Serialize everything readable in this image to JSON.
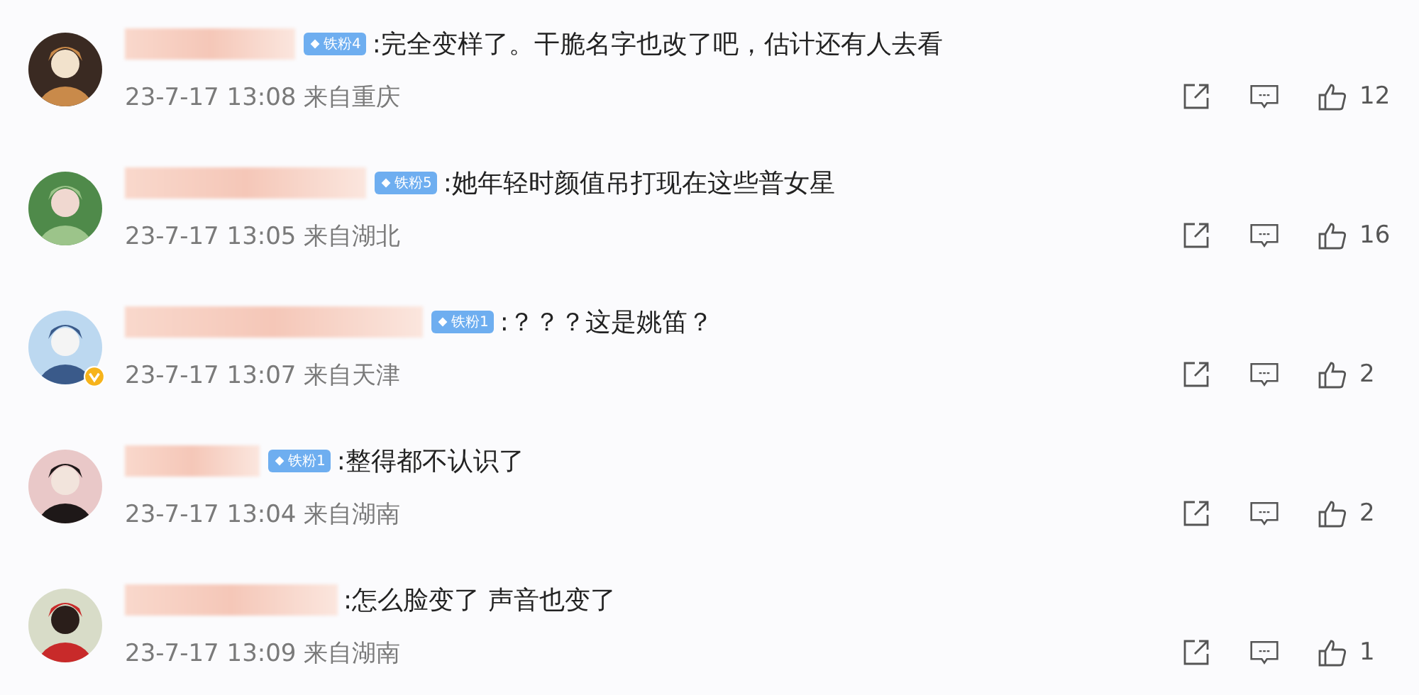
{
  "comments": [
    {
      "avatar": {
        "kind": "picture",
        "verified": false
      },
      "badge": "铁粉4",
      "text": ":完全变样了。干脆名字也改了吧，估计还有人去看",
      "time": "23-7-17 13:08 来自重庆",
      "likes": "12"
    },
    {
      "avatar": {
        "kind": "picture",
        "verified": false
      },
      "badge": "铁粉5",
      "text": ":她年轻时颜值吊打现在这些普女星",
      "time": "23-7-17 13:05 来自湖北",
      "likes": "16"
    },
    {
      "avatar": {
        "kind": "picture",
        "verified": true
      },
      "badge": "铁粉1",
      "text": ":？？？这是姚笛？",
      "time": "23-7-17 13:07 来自天津",
      "likes": "2"
    },
    {
      "avatar": {
        "kind": "picture",
        "verified": false
      },
      "badge": "铁粉1",
      "text": ":整得都不认识了",
      "time": "23-7-17 13:04 来自湖南",
      "likes": "2"
    },
    {
      "avatar": {
        "kind": "picture",
        "verified": false
      },
      "text": ":怎么脸变了 声音也变了",
      "time": "23-7-17 13:09 来自湖南",
      "likes": "1"
    }
  ]
}
